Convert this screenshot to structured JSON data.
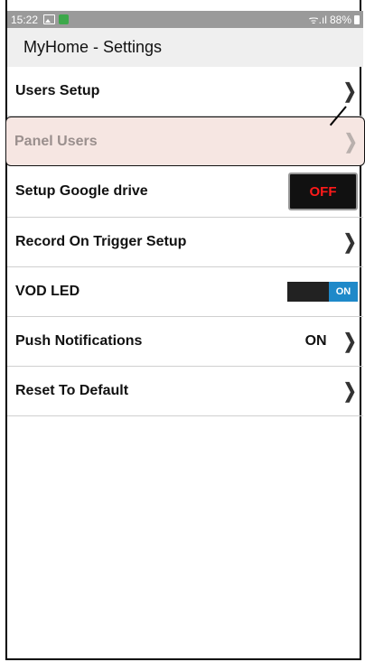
{
  "status_bar": {
    "time": "15:22",
    "signal": "ᯤ.ıl",
    "battery_percent": "88%"
  },
  "header": {
    "title": "MyHome - Settings"
  },
  "settings": {
    "users_setup": "Users Setup",
    "panel_users": "Panel Users",
    "setup_google_drive": "Setup Google drive",
    "google_drive_toggle": "OFF",
    "record_on_trigger": "Record On Trigger Setup",
    "vod_led": "VOD LED",
    "vod_led_toggle": "ON",
    "push_notifications": "Push Notifications",
    "push_notifications_value": "ON",
    "reset_to_default": "Reset To Default"
  },
  "colors": {
    "status_bar": "#9a9a9a",
    "highlight_bg": "#f6e6e2",
    "toggle_on_blue": "#1f89c9",
    "toggle_off_red": "#ff1a1a"
  }
}
